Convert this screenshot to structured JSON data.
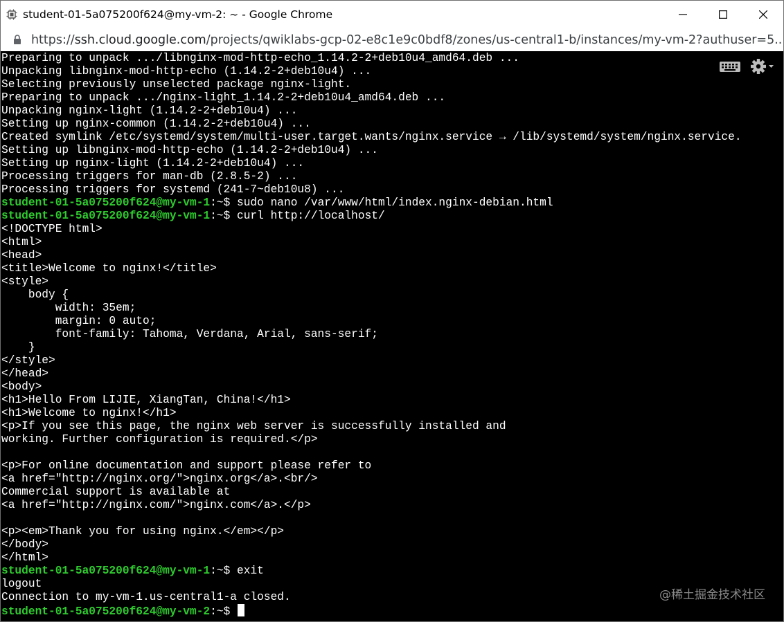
{
  "window": {
    "title": "student-01-5a075200f624@my-vm-2: ~ - Google Chrome",
    "icons": [
      "chrome-app-icon",
      "minimize-icon",
      "maximize-icon",
      "close-icon"
    ]
  },
  "address_bar": {
    "scheme": "https://",
    "host": "ssh.cloud.google.com",
    "path": "/projects/qwiklabs-gcp-02-e8c1e9c0bdf8/zones/us-central1-b/instances/my-vm-2?authuser=5..."
  },
  "terminal": {
    "lines": [
      {
        "prompt": "",
        "sep": "",
        "text": "Preparing to unpack .../libnginx-mod-http-echo_1.14.2-2+deb10u4_amd64.deb ..."
      },
      {
        "prompt": "",
        "sep": "",
        "text": "Unpacking libnginx-mod-http-echo (1.14.2-2+deb10u4) ..."
      },
      {
        "prompt": "",
        "sep": "",
        "text": "Selecting previously unselected package nginx-light."
      },
      {
        "prompt": "",
        "sep": "",
        "text": "Preparing to unpack .../nginx-light_1.14.2-2+deb10u4_amd64.deb ..."
      },
      {
        "prompt": "",
        "sep": "",
        "text": "Unpacking nginx-light (1.14.2-2+deb10u4) ..."
      },
      {
        "prompt": "",
        "sep": "",
        "text": "Setting up nginx-common (1.14.2-2+deb10u4) ..."
      },
      {
        "prompt": "",
        "sep": "",
        "text": "Created symlink /etc/systemd/system/multi-user.target.wants/nginx.service → /lib/systemd/system/nginx.service."
      },
      {
        "prompt": "",
        "sep": "",
        "text": "Setting up libnginx-mod-http-echo (1.14.2-2+deb10u4) ..."
      },
      {
        "prompt": "",
        "sep": "",
        "text": "Setting up nginx-light (1.14.2-2+deb10u4) ..."
      },
      {
        "prompt": "",
        "sep": "",
        "text": "Processing triggers for man-db (2.8.5-2) ..."
      },
      {
        "prompt": "",
        "sep": "",
        "text": "Processing triggers for systemd (241-7~deb10u8) ..."
      },
      {
        "prompt": "student-01-5a075200f624@my-vm-1",
        "sep": ":~$ ",
        "text": "sudo nano /var/www/html/index.nginx-debian.html"
      },
      {
        "prompt": "student-01-5a075200f624@my-vm-1",
        "sep": ":~$ ",
        "text": "curl http://localhost/"
      },
      {
        "prompt": "",
        "sep": "",
        "text": "<!DOCTYPE html>"
      },
      {
        "prompt": "",
        "sep": "",
        "text": "<html>"
      },
      {
        "prompt": "",
        "sep": "",
        "text": "<head>"
      },
      {
        "prompt": "",
        "sep": "",
        "text": "<title>Welcome to nginx!</title>"
      },
      {
        "prompt": "",
        "sep": "",
        "text": "<style>"
      },
      {
        "prompt": "",
        "sep": "",
        "text": "    body {"
      },
      {
        "prompt": "",
        "sep": "",
        "text": "        width: 35em;"
      },
      {
        "prompt": "",
        "sep": "",
        "text": "        margin: 0 auto;"
      },
      {
        "prompt": "",
        "sep": "",
        "text": "        font-family: Tahoma, Verdana, Arial, sans-serif;"
      },
      {
        "prompt": "",
        "sep": "",
        "text": "    }"
      },
      {
        "prompt": "",
        "sep": "",
        "text": "</style>"
      },
      {
        "prompt": "",
        "sep": "",
        "text": "</head>"
      },
      {
        "prompt": "",
        "sep": "",
        "text": "<body>"
      },
      {
        "prompt": "",
        "sep": "",
        "text": "<h1>Hello From LIJIE, XiangTan, China!</h1>"
      },
      {
        "prompt": "",
        "sep": "",
        "text": "<h1>Welcome to nginx!</h1>"
      },
      {
        "prompt": "",
        "sep": "",
        "text": "<p>If you see this page, the nginx web server is successfully installed and"
      },
      {
        "prompt": "",
        "sep": "",
        "text": "working. Further configuration is required.</p>"
      },
      {
        "prompt": "",
        "sep": "",
        "text": ""
      },
      {
        "prompt": "",
        "sep": "",
        "text": "<p>For online documentation and support please refer to"
      },
      {
        "prompt": "",
        "sep": "",
        "text": "<a href=\"http://nginx.org/\">nginx.org</a>.<br/>"
      },
      {
        "prompt": "",
        "sep": "",
        "text": "Commercial support is available at"
      },
      {
        "prompt": "",
        "sep": "",
        "text": "<a href=\"http://nginx.com/\">nginx.com</a>.</p>"
      },
      {
        "prompt": "",
        "sep": "",
        "text": ""
      },
      {
        "prompt": "",
        "sep": "",
        "text": "<p><em>Thank you for using nginx.</em></p>"
      },
      {
        "prompt": "",
        "sep": "",
        "text": "</body>"
      },
      {
        "prompt": "",
        "sep": "",
        "text": "</html>"
      },
      {
        "prompt": "student-01-5a075200f624@my-vm-1",
        "sep": ":~$ ",
        "text": "exit"
      },
      {
        "prompt": "",
        "sep": "",
        "text": "logout"
      },
      {
        "prompt": "",
        "sep": "",
        "text": "Connection to my-vm-1.us-central1-a closed."
      },
      {
        "prompt": "student-01-5a075200f624@my-vm-2",
        "sep": ":~$ ",
        "text": ""
      }
    ],
    "tools": [
      "keyboard-icon",
      "settings-gear-icon"
    ]
  },
  "watermark": "@稀土掘金技术社区",
  "colors": {
    "terminal_bg": "#000000",
    "terminal_fg": "#ffffff",
    "prompt": "#2ecc2e"
  }
}
